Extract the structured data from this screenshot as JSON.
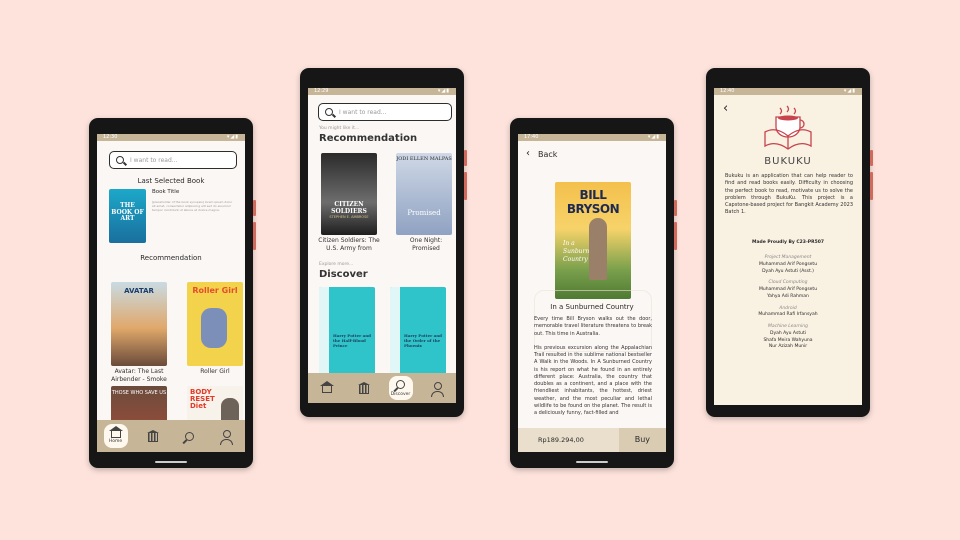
{
  "status": {
    "phone1": {
      "time": "12:30"
    },
    "phone2": {
      "time": "12:29"
    },
    "phone3": {
      "time": "17:40"
    },
    "phone4": {
      "time": "12:40"
    }
  },
  "colors": {
    "background": "#fde3dc",
    "bar": "#c7b597",
    "price_bar": "#e9dfcc"
  },
  "home": {
    "search_placeholder": "I want to read...",
    "last_selected_heading": "Last Selected Book",
    "book_title": "Book Title",
    "book_description": "[placeholder of the book synopsis] lorem ipsum dolor sit amet, consectetur adipiscing elit sed do eiusmod tempor incididunt ut labore et dolore magna.",
    "last_cover_text": "THE BOOK OF ART",
    "recommendation_heading": "Recommendation",
    "books": [
      {
        "caption": "Avatar: The Last Airbender - Smoke",
        "cover_text": "AVATAR"
      },
      {
        "caption": "Roller Girl",
        "cover_text": "Roller Girl"
      },
      {
        "caption": "",
        "cover_text": "THOSE WHO SAVE US"
      },
      {
        "caption": "",
        "cover_text": "BODY RESET Diet"
      }
    ],
    "nav": {
      "home": "Home"
    }
  },
  "discover": {
    "search_placeholder": "I want to read...",
    "you_might_like": "You might like it...",
    "recommendation_heading": "Recommendation",
    "books": [
      {
        "caption": "Citizen Soldiers: The U.S. Army from",
        "cover_title": "CITIZEN SOLDIERS",
        "cover_author": "STEPHEN E. AMBROSE"
      },
      {
        "caption": "One Night: Promised",
        "cover_title": "Promised",
        "cover_author": "JODI ELLEN MALPAS"
      }
    ],
    "explore_more": "Explore more...",
    "discover_heading": "Discover",
    "discover_books": [
      {
        "cover_title": "Harry Potter and the Half-Blood Prince"
      },
      {
        "cover_title": "Harry Potter and the Order of the Phoenix"
      }
    ],
    "nav": {
      "discover": "Discover"
    }
  },
  "detail": {
    "back": "Back",
    "cover_author": "BILL BRYSON",
    "cover_title": "In a Sunburned Country",
    "title": "In a Sunburned Country",
    "para1": "Every time Bill Bryson walks out the door, memorable travel literature threatens to break out. This time in Australia.",
    "para2": "His previous excursion along the Appalachian Trail resulted in the sublime national bestseller A Walk in the Woods. In A Sunburned Country is his report on what he found in an entirely different place: Australia, the country that doubles as a continent, and a place with the friendliest inhabitants, the hottest, driest weather, and the most peculiar and lethal wildlife to be found on the planet. The result is a deliciously funny, fact-filled and",
    "price": "Rp189.294,00",
    "buy": "Buy"
  },
  "about": {
    "app_name": "BUKUKU",
    "description": "Bukuku is an application that can help reader to find and read books easily. Difficulty in choosing the perfect book to read, motivate us to solve the problem through BukuKu. This project is a Capstone-based project for Bangkit Academy 2023 Batch 1.",
    "made_by": "Made Proudly By C23-PR507",
    "teams": [
      {
        "role": "Project Management",
        "members": [
          "Muhammad Arif Pongsetu",
          "Dyah Ayu Astuti (Asst.)"
        ]
      },
      {
        "role": "Cloud Computing",
        "members": [
          "Muhammad Arif Pongsetu",
          "Yahya Adi Rahman"
        ]
      },
      {
        "role": "Android",
        "members": [
          "Muhammad Rafi Irfansyah"
        ]
      },
      {
        "role": "Machine Learning",
        "members": [
          "Dyah Ayu Astuti",
          "Shafa Meira Wahyuna",
          "Nur Azizah Munir"
        ]
      }
    ]
  }
}
